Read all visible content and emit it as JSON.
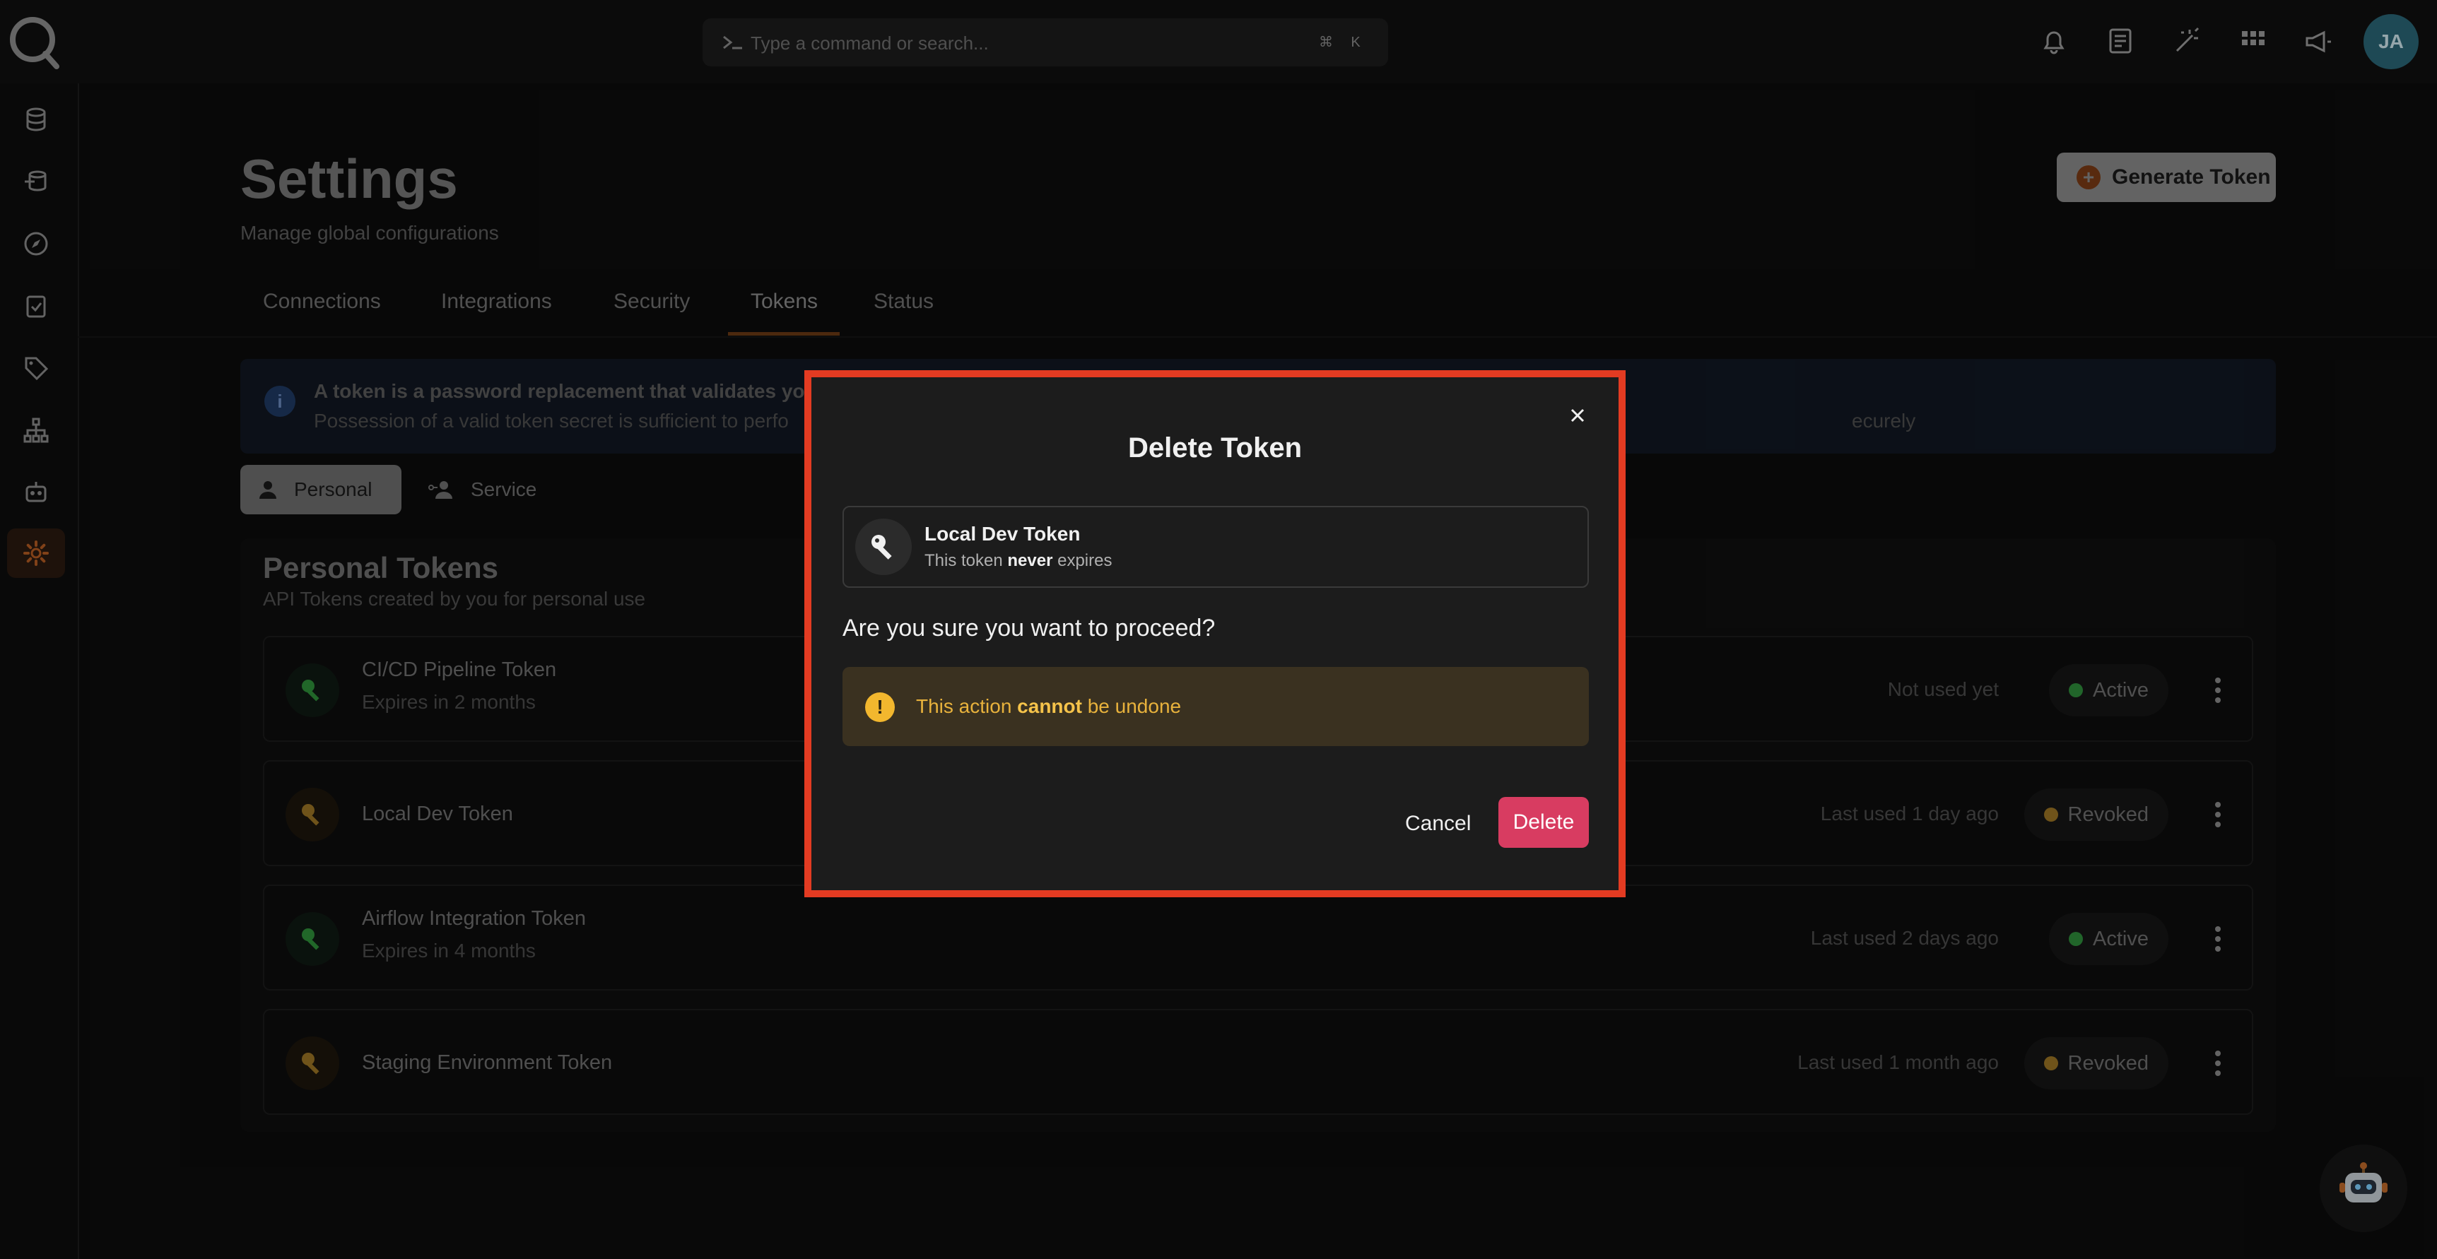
{
  "search": {
    "placeholder": "Type a command or search...",
    "key_1": "⌘",
    "key_2": "K"
  },
  "user": {
    "initials": "JA"
  },
  "page": {
    "title": "Settings",
    "subtitle": "Manage global configurations",
    "generate_label": "Generate Token"
  },
  "tabs": [
    {
      "label": "Connections"
    },
    {
      "label": "Integrations"
    },
    {
      "label": "Security"
    },
    {
      "label": "Tokens"
    },
    {
      "label": "Status"
    }
  ],
  "info": {
    "line1": "A token is a password replacement that validates yo",
    "line2": "Possession of a valid token secret is sufficient to perfo",
    "line2_tail": "ecurely"
  },
  "segments": {
    "personal": "Personal",
    "service": "Service"
  },
  "tokens_card": {
    "title": "Personal Tokens",
    "subtitle": "API Tokens created by you for personal use"
  },
  "tokens": [
    {
      "name": "CI/CD Pipeline Token",
      "expires": "Expires in 2 months",
      "used": "Not used yet",
      "status": "Active",
      "status_color": "#3bb54a"
    },
    {
      "name": "Local Dev Token",
      "expires": "",
      "used": "Last used 1 day ago",
      "status": "Revoked",
      "status_color": "#c9962a"
    },
    {
      "name": "Airflow Integration Token",
      "expires": "Expires in 4 months",
      "used": "Last used 2 days ago",
      "status": "Active",
      "status_color": "#3bb54a"
    },
    {
      "name": "Staging Environment Token",
      "expires": "",
      "used": "Last used 1 month ago",
      "status": "Revoked",
      "status_color": "#c9962a"
    }
  ],
  "modal": {
    "title": "Delete Token",
    "token_name": "Local Dev Token",
    "expiry_prefix": "This token ",
    "expiry_strong": "never",
    "expiry_suffix": " expires",
    "question": "Are you sure you want to proceed?",
    "warning_prefix": "This action ",
    "warning_strong": "cannot",
    "warning_suffix": " be undone",
    "cancel_label": "Cancel",
    "delete_label": "Delete"
  },
  "colors": {
    "accent": "#e0702a",
    "highlight": "#e33b22",
    "delete": "#d83c61",
    "warning": "#f2b72e"
  }
}
